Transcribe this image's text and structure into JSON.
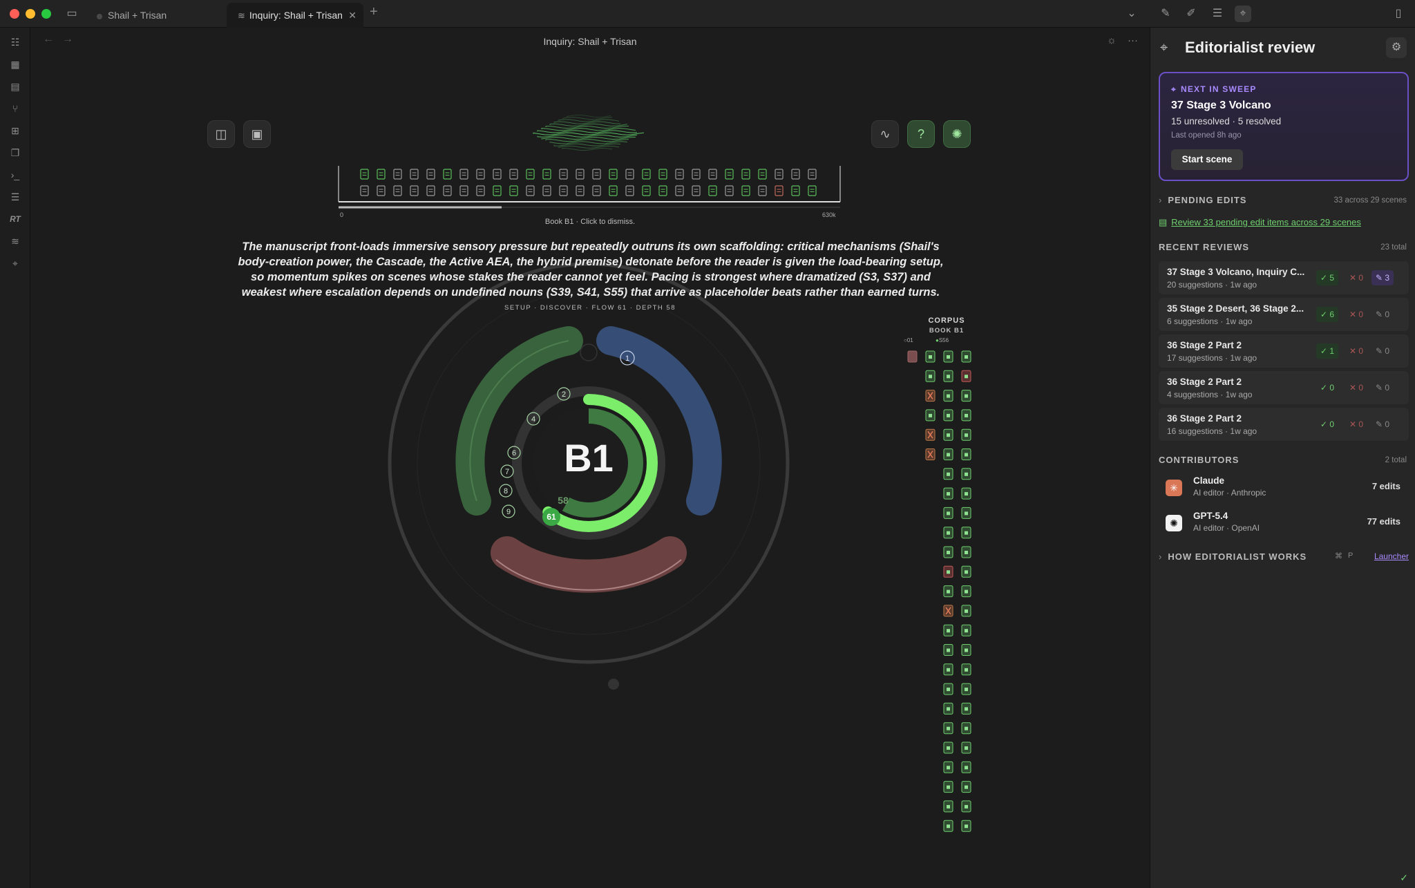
{
  "tabs": [
    {
      "label": "Shail + Trisan"
    },
    {
      "label": "Inquiry: Shail + Trisan"
    }
  ],
  "main": {
    "title": "Inquiry: Shail + Trisan",
    "timeline": {
      "axis_start": "0",
      "axis_end": "630k",
      "dismiss_hint": "Book B1 · Click to dismiss."
    },
    "summary": "The manuscript front-loads immersive sensory pressure but repeatedly outruns its own scaffolding: critical mechanisms (Shail's body-creation power, the Cascade, the Active AEA, the hybrid premise) detonate before the reader is given the load-bearing setup, so momentum spikes on scenes whose stakes the reader cannot yet feel. Pacing is strongest where dramatized (S3, S37) and weakest where escalation depends on undefined nouns (S39, S41, S55) that arrive as placeholder beats rather than earned turns.",
    "phase_line": "SETUP · DISCOVER · FLOW 61 · DEPTH 58",
    "dial": {
      "center_label": "B1",
      "flow_label": "61",
      "depth_label": "58",
      "flow_value": 61,
      "depth_value": 58,
      "green_arc_numbers": [
        "2",
        "4",
        "6",
        "7",
        "8",
        "9"
      ],
      "blue_arc_numbers": [
        "1"
      ]
    },
    "corpus": {
      "title": "CORPUS",
      "subtitle": "BOOK B1",
      "legend_left": "01",
      "legend_right": "S56"
    }
  },
  "sidebar": {
    "title": "Editorialist review",
    "next_in_sweep": {
      "tag": "NEXT IN SWEEP",
      "scene": "37 Stage 3 Volcano",
      "stats": "15 unresolved · 5 resolved",
      "last_opened": "Last opened 8h ago",
      "button": "Start scene"
    },
    "pending": {
      "heading": "PENDING EDITS",
      "count": "33 across 29 scenes",
      "link": "Review 33 pending edit items across 29 scenes"
    },
    "recent": {
      "heading": "RECENT REVIEWS",
      "count": "23 total",
      "items": [
        {
          "title": "37 Stage 3 Volcano, Inquiry C...",
          "sub": "20 suggestions · 1w ago",
          "ok": "5",
          "x": "0",
          "ed": "3"
        },
        {
          "title": "35 Stage 2 Desert, 36 Stage 2...",
          "sub": "6 suggestions · 1w ago",
          "ok": "6",
          "x": "0",
          "ed": "0"
        },
        {
          "title": "36 Stage 2 Part 2",
          "sub": "17 suggestions · 1w ago",
          "ok": "1",
          "x": "0",
          "ed": "0"
        },
        {
          "title": "36 Stage 2 Part 2",
          "sub": "4 suggestions · 1w ago",
          "ok": "0",
          "x": "0",
          "ed": "0"
        },
        {
          "title": "36 Stage 2 Part 2",
          "sub": "16 suggestions · 1w ago",
          "ok": "0",
          "x": "0",
          "ed": "0"
        }
      ]
    },
    "contributors": {
      "heading": "CONTRIBUTORS",
      "count": "2 total",
      "items": [
        {
          "name": "Claude",
          "sub": "AI editor · Anthropic",
          "edits": "7 edits"
        },
        {
          "name": "GPT-5.4",
          "sub": "AI editor · OpenAI",
          "edits": "77 edits"
        }
      ]
    },
    "how": {
      "label": "HOW EDITORIALIST WORKS",
      "shortcut_cmd": "⌘",
      "shortcut_key": "P",
      "launcher": "Launcher"
    }
  },
  "colors": {
    "accent_purple": "#6b4fc7",
    "green": "#6fcf6f",
    "arc_green": "#3d6b41",
    "arc_blue": "#3a5480",
    "arc_red": "#7a4848"
  }
}
